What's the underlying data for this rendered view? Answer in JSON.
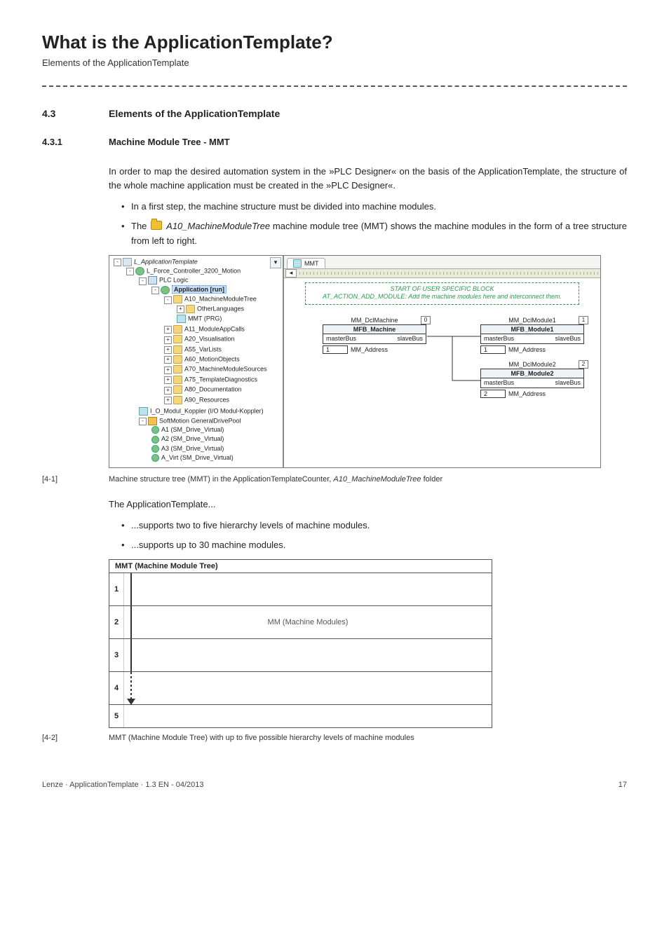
{
  "header": {
    "title": "What is the ApplicationTemplate?",
    "subtitle": "Elements of the ApplicationTemplate"
  },
  "section": {
    "num": "4.3",
    "title": "Elements of the ApplicationTemplate"
  },
  "subsection": {
    "num": "4.3.1",
    "title": "Machine Module Tree - MMT"
  },
  "para1": "In order to map the desired automation system in the »PLC Designer« on the basis of the ApplicationTemplate, the structure of the whole machine application must be created in the »PLC Designer«.",
  "b1": "In a first step, the machine structure must be divided into machine modules.",
  "b2a": "The ",
  "b2b": "A10_MachineModuleTree",
  "b2c": " machine module tree (MMT) shows the machine modules in the form of a tree structure from left to right.",
  "tree": {
    "root": "L_ApplicationTemplate",
    "ctrl": "L_Force_Controller_3200_Motion",
    "plc": "PLC Logic",
    "app": "Application [run]",
    "a10": "A10_MachineModuleTree",
    "other": "OtherLanguages",
    "mmt": "MMT (PRG)",
    "a11": "A11_ModuleAppCalls",
    "a20": "A20_Visualisation",
    "a55": "A55_VarLists",
    "a60": "A60_MotionObjects",
    "a70": "A70_MachineModuleSources",
    "a75": "A75_TemplateDiagnostics",
    "a80": "A80_Documentation",
    "a90": "A90_Resources",
    "kop": "I_O_Modul_Koppler (I/O Modul-Koppler)",
    "pool": "SoftMotion GeneralDrivePool",
    "a1": "A1 (SM_Drive_Virtual)",
    "a2": "A2 (SM_Drive_Virtual)",
    "a3": "A3 (SM_Drive_Virtual)",
    "avirt": "A_Virt (SM_Drive_Virtual)"
  },
  "diag": {
    "tab": "MMT",
    "banner1": "START OF USER SPECIFIC BLOCK",
    "banner2": "AT_ACTION_ADD_MODULE: Add the machine modules here and interconnect them.",
    "fb0": {
      "inst": "MM_DclMachine",
      "type": "MFB_Machine",
      "pin_l": "masterBus",
      "pin_r": "slaveBus",
      "addr_l": "MM_Address",
      "id": "0",
      "val": "1"
    },
    "fb1": {
      "inst": "MM_DclModule1",
      "type": "MFB_Module1",
      "pin_l": "masterBus",
      "pin_r": "slaveBus",
      "addr_l": "MM_Address",
      "id": "1",
      "val": "1"
    },
    "fb2": {
      "inst": "MM_DclModule2",
      "type": "MFB_Module2",
      "pin_l": "masterBus",
      "pin_r": "slaveBus",
      "addr_l": "MM_Address",
      "id": "2",
      "val": "2"
    }
  },
  "cap1": {
    "tag": "[4-1]",
    "text_a": "Machine structure tree (MMT) in the ApplicationTemplateCounter, ",
    "text_b": "A10_MachineModuleTree",
    "text_c": " folder"
  },
  "para2": "The ApplicationTemplate...",
  "b3": "...supports two to five hierarchy levels of machine modules.",
  "b4": "...supports up to 30 machine modules.",
  "fig2": {
    "hdr": "MMT (Machine Module Tree)",
    "mm": "MM (Machine Modules)",
    "r1": "1",
    "r2": "2",
    "r3": "3",
    "r4": "4",
    "r5": "5"
  },
  "cap2": {
    "tag": "[4-2]",
    "text": "MMT (Machine Module Tree) with up to five possible hierarchy levels of machine modules"
  },
  "footer": {
    "left": "Lenze · ApplicationTemplate · 1.3 EN - 04/2013",
    "right": "17"
  }
}
